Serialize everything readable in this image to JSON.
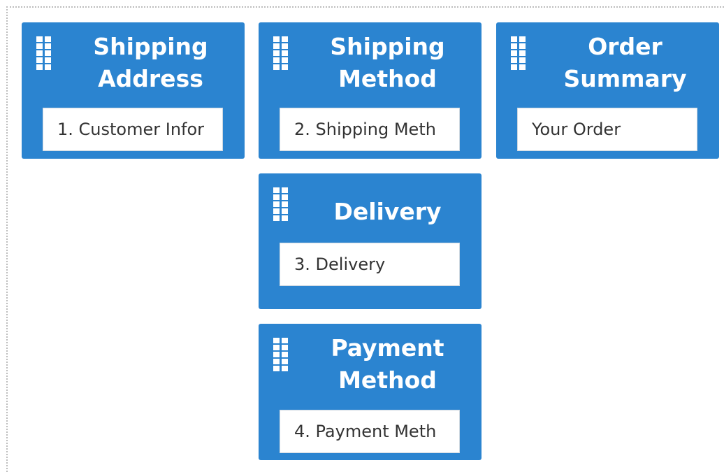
{
  "colors": {
    "card_background": "#2b84d0",
    "card_title_text": "#ffffff",
    "input_background": "#ffffff",
    "input_text": "#333333",
    "dotted_border": "#bdbdbd"
  },
  "cards": [
    {
      "title": "Shipping\nAddress",
      "icon": "drag-handle-icon",
      "input_value": "1. Customer Infor"
    },
    {
      "title": "Shipping\nMethod",
      "icon": "drag-handle-icon",
      "input_value": "2. Shipping Meth"
    },
    {
      "title": "Order\nSummary",
      "icon": "drag-handle-icon",
      "input_value": "Your Order"
    },
    {
      "title": "Delivery",
      "icon": "drag-handle-icon",
      "input_value": "3. Delivery"
    },
    {
      "title": "Payment\nMethod",
      "icon": "drag-handle-icon",
      "input_value": "4. Payment Meth"
    }
  ]
}
